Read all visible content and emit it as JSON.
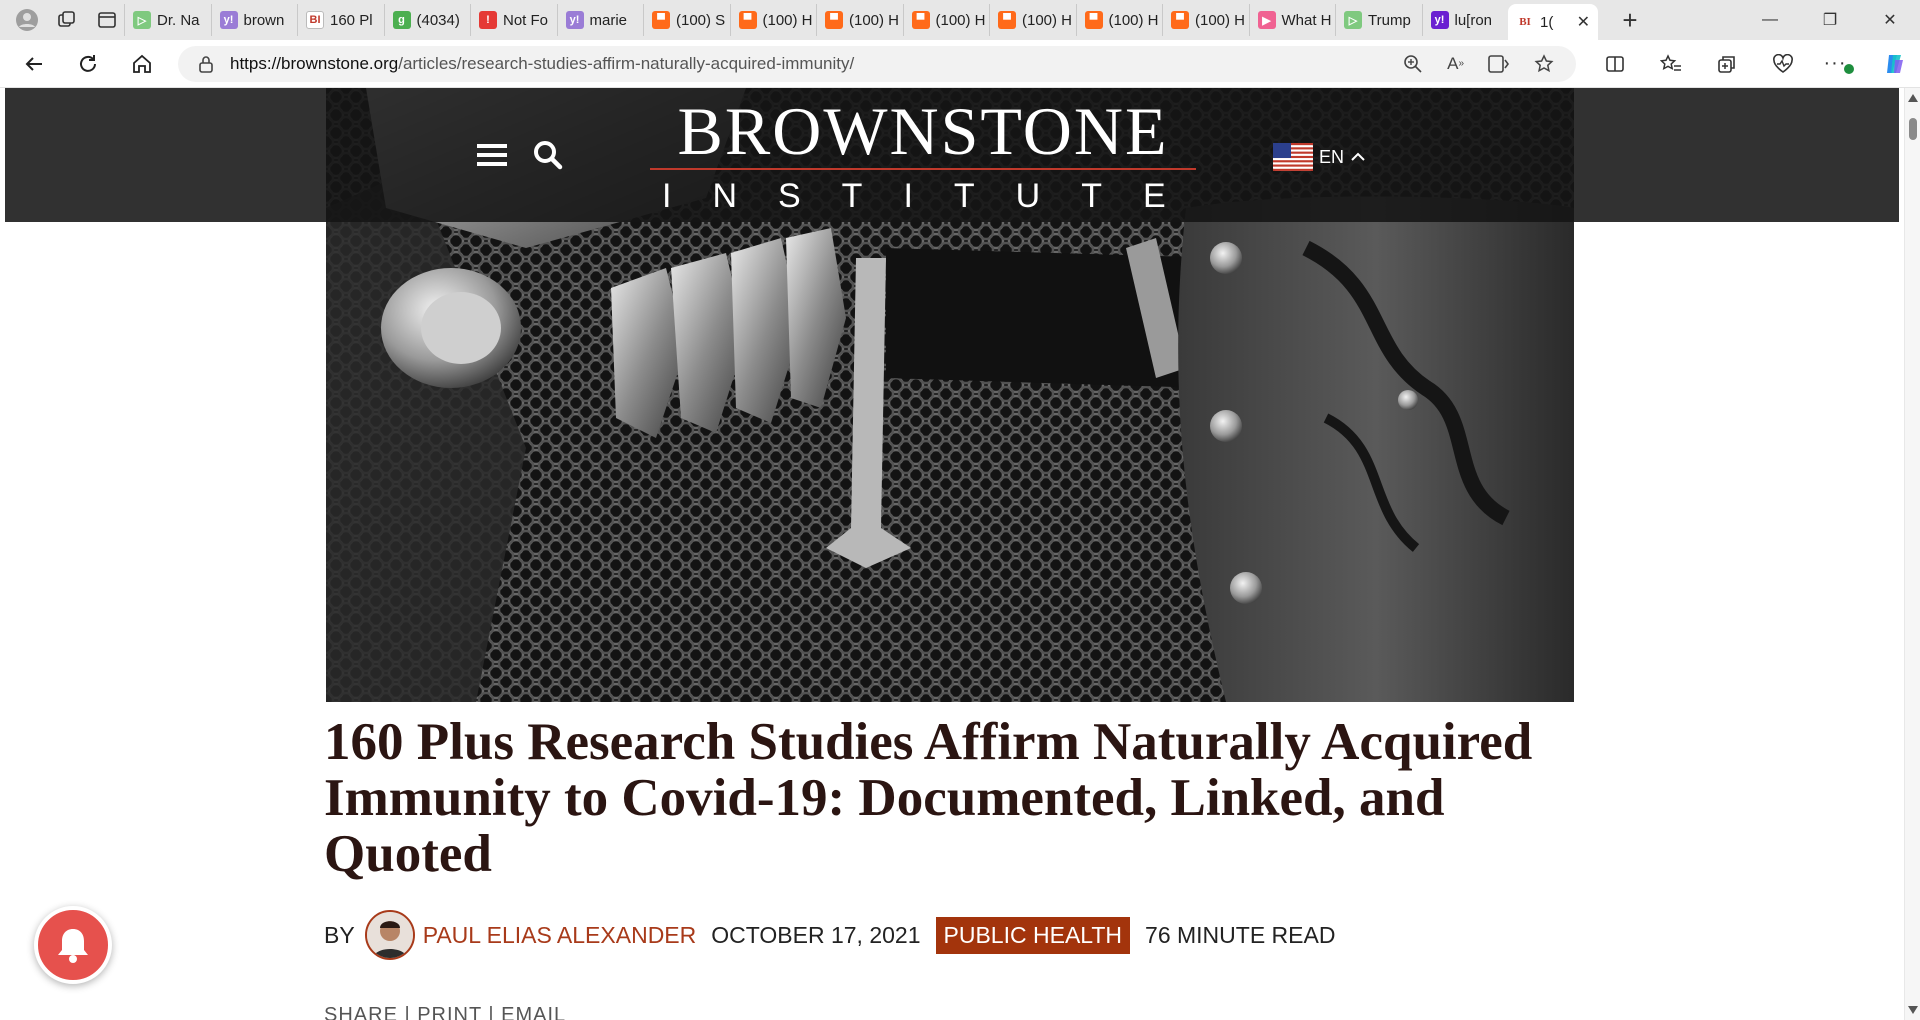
{
  "browser": {
    "tabs": [
      {
        "label": "Dr. Na",
        "fav_color": "#7fc97f",
        "fav_text": "▷"
      },
      {
        "label": "brown",
        "fav_color": "#9a7cd6",
        "fav_text": "y!"
      },
      {
        "label": "160 Pl",
        "fav_color": "#ffffff",
        "fav_text": "BI"
      },
      {
        "label": "(4034)",
        "fav_color": "#4caf50",
        "fav_text": "g"
      },
      {
        "label": "Not Fo",
        "fav_color": "#e53935",
        "fav_text": "!"
      },
      {
        "label": "marie",
        "fav_color": "#9a7cd6",
        "fav_text": "y!"
      },
      {
        "label": "(100) S",
        "fav_color": "#ff6a1a",
        "fav_text": "▀"
      },
      {
        "label": "(100) H",
        "fav_color": "#ff6a1a",
        "fav_text": "▀"
      },
      {
        "label": "(100) H",
        "fav_color": "#ff6a1a",
        "fav_text": "▀"
      },
      {
        "label": "(100) H",
        "fav_color": "#ff6a1a",
        "fav_text": "▀"
      },
      {
        "label": "(100) H",
        "fav_color": "#ff6a1a",
        "fav_text": "▀"
      },
      {
        "label": "(100) H",
        "fav_color": "#ff6a1a",
        "fav_text": "▀"
      },
      {
        "label": "(100) H",
        "fav_color": "#ff6a1a",
        "fav_text": "▀"
      },
      {
        "label": "What H",
        "fav_color": "#f06292",
        "fav_text": "▶"
      },
      {
        "label": "Trump",
        "fav_color": "#7fc97f",
        "fav_text": "▷"
      },
      {
        "label": "lu[ron",
        "fav_color": "#6a1fd1",
        "fav_text": "y!"
      }
    ],
    "active_tab": {
      "label": "1(",
      "fav_text": "BI",
      "fav_color": "#c0392b"
    },
    "url_host": "https://brownstone.org",
    "url_path": "/articles/research-studies-affirm-naturally-acquired-immunity/"
  },
  "site": {
    "logo_line1": "BROWNSTONE",
    "logo_line2": "INSTITUTE",
    "lang": "EN",
    "accent_color": "#a3340c"
  },
  "article": {
    "title": "160 Plus Research Studies Affirm Naturally Acquired Immunity to Covid-19: Documented, Linked, and Quoted",
    "by": "BY",
    "author": "PAUL ELIAS ALEXANDER",
    "date": "OCTOBER 17, 2021",
    "category": "PUBLIC HEALTH",
    "read_time": "76 MINUTE READ",
    "share_line": "SHARE | PRINT | EMAIL"
  }
}
